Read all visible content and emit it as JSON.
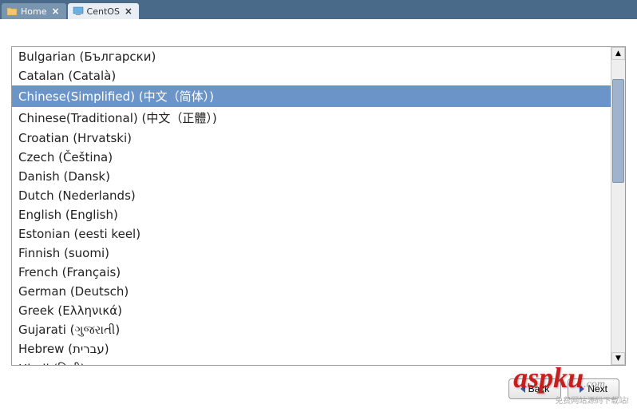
{
  "tabs": [
    {
      "label": "Home",
      "active": false
    },
    {
      "label": "CentOS",
      "active": true
    }
  ],
  "languages": [
    {
      "label": "Bulgarian (Български)",
      "selected": false
    },
    {
      "label": "Catalan (Català)",
      "selected": false
    },
    {
      "label": "Chinese(Simplified) (中文（简体）)",
      "selected": true
    },
    {
      "label": "Chinese(Traditional) (中文（正體）)",
      "selected": false
    },
    {
      "label": "Croatian (Hrvatski)",
      "selected": false
    },
    {
      "label": "Czech (Čeština)",
      "selected": false
    },
    {
      "label": "Danish (Dansk)",
      "selected": false
    },
    {
      "label": "Dutch (Nederlands)",
      "selected": false
    },
    {
      "label": "English (English)",
      "selected": false
    },
    {
      "label": "Estonian (eesti keel)",
      "selected": false
    },
    {
      "label": "Finnish (suomi)",
      "selected": false
    },
    {
      "label": "French (Français)",
      "selected": false
    },
    {
      "label": "German (Deutsch)",
      "selected": false
    },
    {
      "label": "Greek (Ελληνικά)",
      "selected": false
    },
    {
      "label": "Gujarati (ગુજરાતી)",
      "selected": false
    },
    {
      "label": "Hebrew (עברית)",
      "selected": false
    },
    {
      "label": "Hindi (हिन्दी)",
      "selected": false
    }
  ],
  "buttons": {
    "back": "Back",
    "next": "Next"
  },
  "watermark": {
    "main": "aspku",
    "suffix": ".com",
    "cn": "免费网站源码下载站!"
  }
}
